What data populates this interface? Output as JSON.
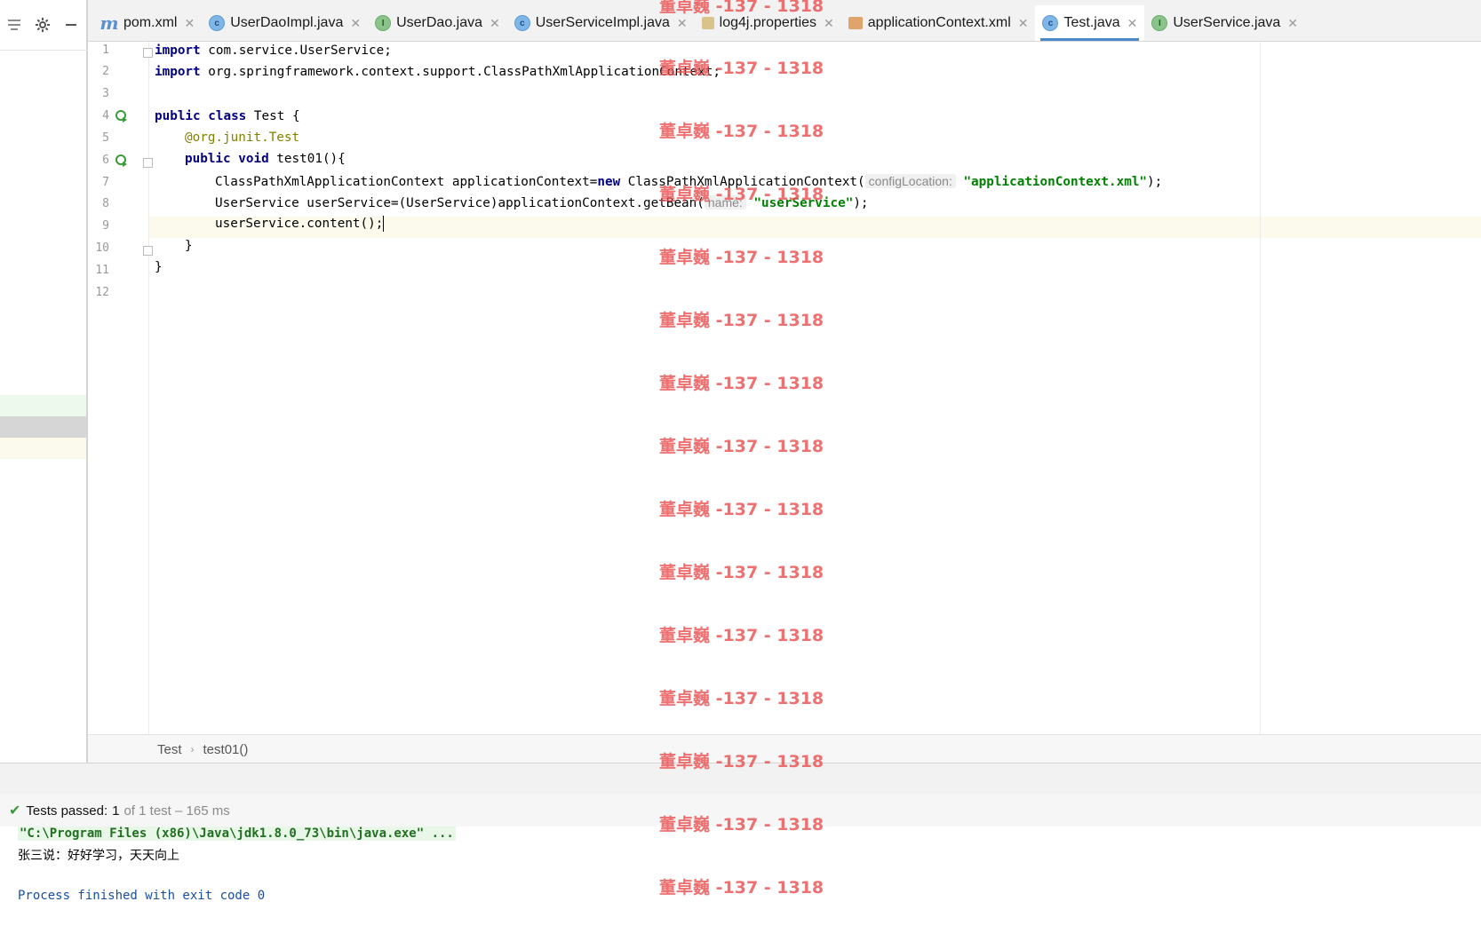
{
  "toolbar": {
    "icons": [
      "collapse-icon",
      "gear-icon",
      "minimize-icon"
    ]
  },
  "tabs": [
    {
      "label": "pom.xml",
      "icon": "m",
      "active": false
    },
    {
      "label": "UserDaoImpl.java",
      "icon": "c",
      "active": false
    },
    {
      "label": "UserDao.java",
      "icon": "i",
      "active": false
    },
    {
      "label": "UserServiceImpl.java",
      "icon": "c",
      "active": false
    },
    {
      "label": "log4j.properties",
      "icon": "prop",
      "active": false
    },
    {
      "label": "applicationContext.xml",
      "icon": "xml",
      "active": false
    },
    {
      "label": "Test.java",
      "icon": "c",
      "active": true
    },
    {
      "label": "UserService.java",
      "icon": "i",
      "active": false
    }
  ],
  "editor": {
    "line_numbers": [
      "1",
      "2",
      "3",
      "4",
      "5",
      "6",
      "7",
      "8",
      "9",
      "10",
      "11",
      "12"
    ],
    "lines": {
      "l1_kw": "import",
      "l1_rest": " com.service.UserService;",
      "l2_kw": "import",
      "l2_rest": " org.springframework.context.support.ClassPathXmlApplicationContext;",
      "l4_kw": "public class",
      "l4_rest": " Test {",
      "l5_ann": "@org.junit.",
      "l5_ann2": "Test",
      "l6_kw": "public void",
      "l6_rest": " test01(){",
      "l7_a": "ClassPathXmlApplicationContext applicationContext=",
      "l7_kw": "new",
      "l7_b": " ClassPathXmlApplicationContext(",
      "l7_hint": "configLocation:",
      "l7_str": "\"applicationContext.xml\"",
      "l7_end": ");",
      "l8_a": "UserService userService=(UserService)applicationContext.getBean(",
      "l8_hint": "name:",
      "l8_str": "\"userService\"",
      "l8_end": ");",
      "l9": "userService.content();",
      "l10": "}",
      "l11": "}"
    }
  },
  "breadcrumb": {
    "items": [
      "Test",
      "test01()"
    ]
  },
  "run": {
    "status_prefix": "Tests passed:",
    "status_count": "1",
    "status_rest": "of 1 test – 165 ms"
  },
  "console": {
    "cmd": "\"C:\\Program Files (x86)\\Java\\jdk1.8.0_73\\bin\\java.exe\" ...",
    "output": "张三说：好好学习，天天向上",
    "exit": "Process finished with exit code 0"
  },
  "watermark": {
    "text": "董卓巍 -137 - 1318",
    "color": "#ec5050"
  }
}
